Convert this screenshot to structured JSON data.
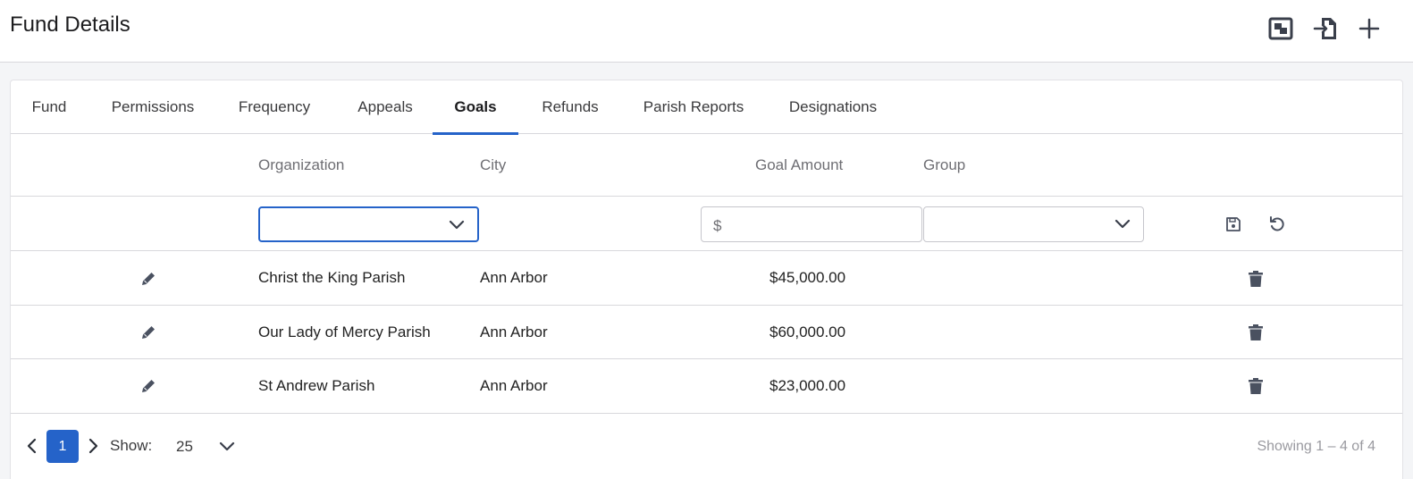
{
  "header": {
    "title": "Fund Details",
    "actions": [
      {
        "name": "fullscreen-icon"
      },
      {
        "name": "export-icon"
      },
      {
        "name": "add-icon"
      }
    ]
  },
  "tabs": [
    {
      "label": "Fund"
    },
    {
      "label": "Permissions"
    },
    {
      "label": "Frequency"
    },
    {
      "label": "Appeals"
    },
    {
      "label": "Goals",
      "active": true
    },
    {
      "label": "Refunds"
    },
    {
      "label": "Parish Reports"
    },
    {
      "label": "Designations"
    }
  ],
  "table": {
    "columns": [
      "Organization",
      "City",
      "Goal Amount",
      "Group"
    ],
    "new_row": {
      "organization_value": "",
      "currency_symbol": "$",
      "amount_value": "",
      "group_value": ""
    },
    "rows": [
      {
        "organization": "Christ the King Parish",
        "city": "Ann Arbor",
        "goal_amount": "$45,000.00",
        "group": ""
      },
      {
        "organization": "Our Lady of Mercy Parish",
        "city": "Ann Arbor",
        "goal_amount": "$60,000.00",
        "group": ""
      },
      {
        "organization": "St Andrew Parish",
        "city": "Ann Arbor",
        "goal_amount": "$23,000.00",
        "group": ""
      }
    ]
  },
  "pagination": {
    "current_page": "1",
    "show_label": "Show:",
    "page_size": "25",
    "showing_text": "Showing 1 – 4 of 4"
  },
  "colors": {
    "accent": "#2563c9",
    "icon": "#4a5160"
  }
}
